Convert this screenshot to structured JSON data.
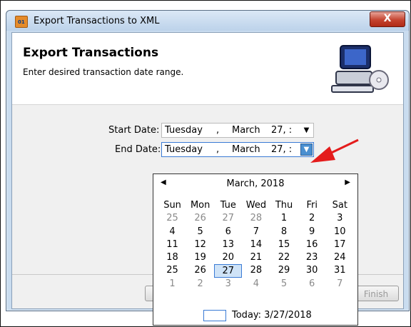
{
  "window": {
    "title": "Export Transactions to XML",
    "close_label": "X"
  },
  "header": {
    "title": "Export Transactions",
    "subtitle": "Enter desired transaction date range."
  },
  "form": {
    "start_label": "Start Date:",
    "start_weekday": "Tuesday",
    "start_sep": ",",
    "start_month": "March",
    "start_day": "27, :",
    "end_label": "End Date:",
    "end_weekday": "Tuesday",
    "end_sep": ",",
    "end_month": "March",
    "end_day": "27, :"
  },
  "buttons": {
    "finish_label": "Finish"
  },
  "calendar": {
    "month_label": "March, 2018",
    "weekdays": [
      "Sun",
      "Mon",
      "Tue",
      "Wed",
      "Thu",
      "Fri",
      "Sat"
    ],
    "weeks": [
      [
        "25",
        "26",
        "27",
        "28",
        "1",
        "2",
        "3"
      ],
      [
        "4",
        "5",
        "6",
        "7",
        "8",
        "9",
        "10"
      ],
      [
        "11",
        "12",
        "13",
        "14",
        "15",
        "16",
        "17"
      ],
      [
        "18",
        "19",
        "20",
        "21",
        "22",
        "23",
        "24"
      ],
      [
        "25",
        "26",
        "27",
        "28",
        "29",
        "30",
        "31"
      ],
      [
        "1",
        "2",
        "3",
        "4",
        "5",
        "6",
        "7"
      ]
    ],
    "dim_rows": {
      "0": [
        0,
        1,
        2,
        3
      ],
      "5": [
        0,
        1,
        2,
        3,
        4,
        5,
        6
      ]
    },
    "selected": {
      "row": 4,
      "col": 2
    },
    "today_label": "Today: 3/27/2018"
  },
  "colors": {
    "accent": "#3a7bd5",
    "annotation_arrow": "#e41c1c",
    "close_button": "#c4432f"
  }
}
